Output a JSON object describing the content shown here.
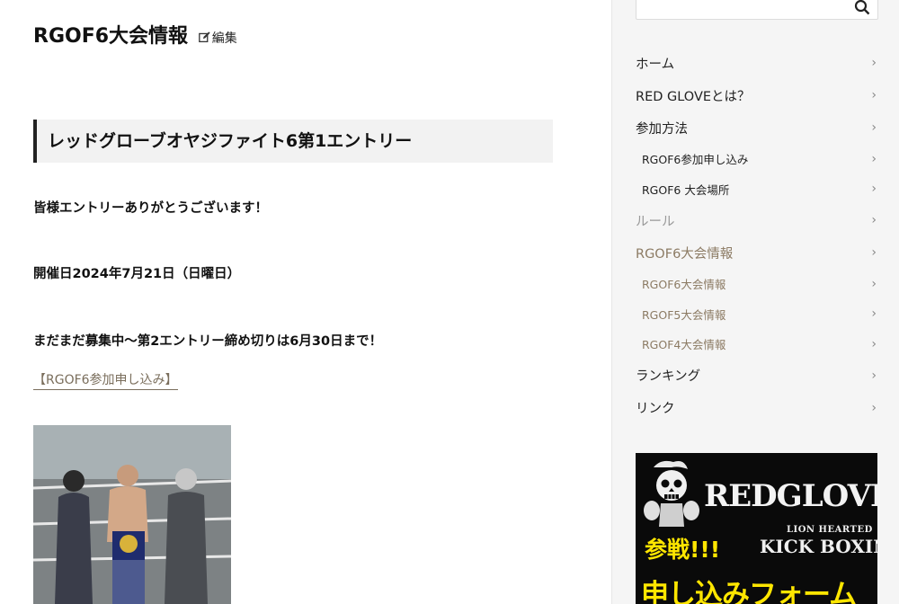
{
  "page": {
    "title": "RGOF6大会情報",
    "edit_label": "編集"
  },
  "article": {
    "heading": "レッドグローブオヤジファイト6第1エントリー",
    "paragraph1": "皆様エントリーありがとうございます！",
    "paragraph2": "開催日2024年7月21日（日曜日）",
    "paragraph3": "まだまだ募集中～第2エントリー締め切りは6月30日まで！",
    "link_label": "【RGOF6参加申し込み】"
  },
  "sidebar": {
    "search": {
      "placeholder": "",
      "icon": "search-icon"
    },
    "nav": [
      {
        "label": "ホーム",
        "level": 1,
        "style": "normal"
      },
      {
        "label": "RED GLOVEとは？",
        "level": 1,
        "style": "normal"
      },
      {
        "label": "参加方法",
        "level": 1,
        "style": "normal"
      },
      {
        "label": "RGOF6参加申し込み",
        "level": 2,
        "style": "normal"
      },
      {
        "label": "RGOF6 大会場所",
        "level": 2,
        "style": "normal"
      },
      {
        "label": "ルール",
        "level": 1,
        "style": "muted"
      },
      {
        "label": "RGOF6大会情報",
        "level": 1,
        "style": "tan"
      },
      {
        "label": "RGOF6大会情報",
        "level": 2,
        "style": "tan"
      },
      {
        "label": "RGOF5大会情報",
        "level": 2,
        "style": "tan"
      },
      {
        "label": "RGOF4大会情報",
        "level": 2,
        "style": "tan"
      },
      {
        "label": "ランキング",
        "level": 1,
        "style": "normal"
      },
      {
        "label": "リンク",
        "level": 1,
        "style": "normal"
      }
    ],
    "banner": {
      "title": "REDGLOVE",
      "subtitle": "LION HEARTED",
      "subtitle2": "KICK BOXING",
      "entry": "参戦!!!",
      "form": "申し込みフォーム"
    }
  },
  "colors": {
    "link_tan": "#8c7b64",
    "muted": "#999999",
    "banner_yellow": "#ffe600",
    "heading_bg": "#f2f2f2"
  }
}
